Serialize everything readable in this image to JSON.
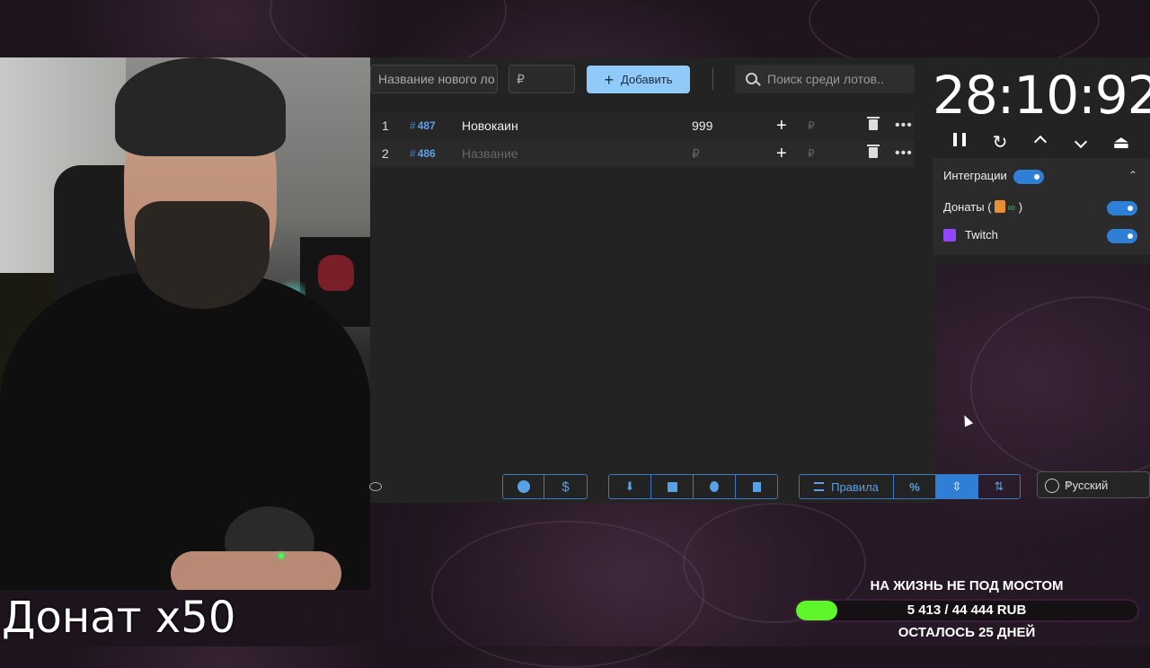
{
  "overlay": {
    "donate_text": "Донат x50"
  },
  "lots_panel": {
    "new_lot_placeholder": "Название нового ло",
    "amount_placeholder": "₽",
    "add_button": "Добавить",
    "search_placeholder": "Поиск среди лотов..",
    "lots": [
      {
        "index": "1",
        "id": "487",
        "name": "Новокаин",
        "amount": "999",
        "currency": "₽"
      },
      {
        "index": "2",
        "id": "486",
        "name": "Название",
        "amount": "₽",
        "currency": "₽"
      }
    ]
  },
  "toolbar": {
    "rules_label": "Правила",
    "percent_label": "%",
    "language": "Русский"
  },
  "timer": {
    "value": "28:10:92"
  },
  "integrations": {
    "title": "Интеграции",
    "enabled": true,
    "donations_label": "Донаты (",
    "donations_suffix": ")",
    "twitch_label": "Twitch"
  },
  "goal": {
    "title": "НА ЖИЗНЬ НЕ ПОД МОСТОМ",
    "amount": "5 413 / 44 444 RUB",
    "days_left": "ОСТАЛОСЬ 25 ДНЕЙ",
    "progress": 0.122,
    "bar_color": "#5ef52a"
  },
  "colors": {
    "accent": "#2f7fd6",
    "add_button": "#90caf9",
    "id_color": "#5aa0e6"
  }
}
